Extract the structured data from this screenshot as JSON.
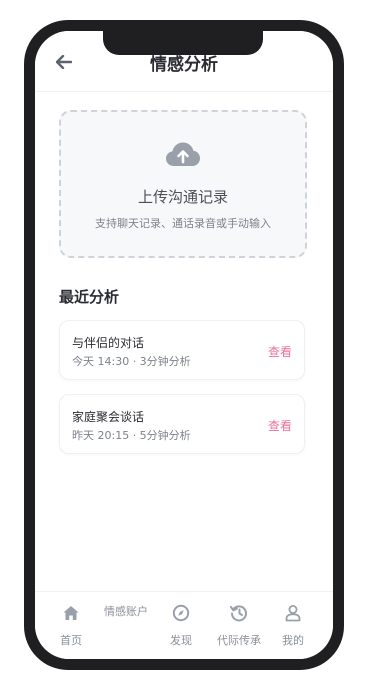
{
  "header": {
    "title": "情感分析",
    "back_icon": "arrow-left-icon"
  },
  "upload": {
    "icon": "cloud-upload-icon",
    "title": "上传沟通记录",
    "subtitle": "支持聊天记录、通话录音或手动输入"
  },
  "recent": {
    "title": "最近分析",
    "items": [
      {
        "title": "与伴侣的对话",
        "meta": "今天 14:30 · 3分钟分析",
        "action": "查看"
      },
      {
        "title": "家庭聚会谈话",
        "meta": "昨天 20:15 · 5分钟分析",
        "action": "查看"
      }
    ]
  },
  "tabbar": {
    "floating_label": "情感账户",
    "tabs": [
      {
        "label": "首页",
        "icon": "home-icon"
      },
      {
        "label": "发现",
        "icon": "compass-icon"
      },
      {
        "label": "代际传承",
        "icon": "history-icon"
      },
      {
        "label": "我的",
        "icon": "user-icon"
      }
    ]
  },
  "colors": {
    "accent": "#e8739a",
    "icon_gray": "#9aa0aa",
    "phone_frame": "#1f1f22"
  }
}
